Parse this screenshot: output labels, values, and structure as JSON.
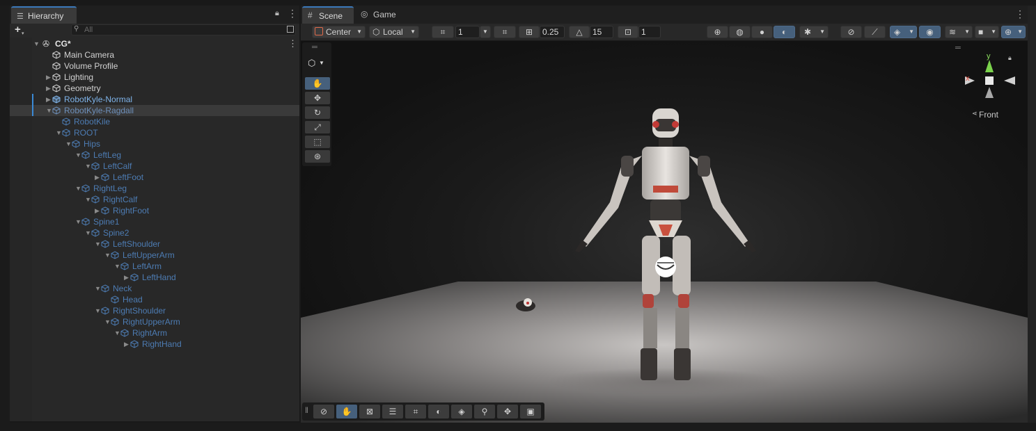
{
  "hierarchy": {
    "tab_label": "Hierarchy",
    "search_placeholder": "All",
    "add_button": "+",
    "scene_name": "CG*",
    "items": [
      {
        "label": "Main Camera",
        "depth": 1,
        "arrow": "none",
        "style": "norm"
      },
      {
        "label": "Volume Profile",
        "depth": 1,
        "arrow": "none",
        "style": "norm"
      },
      {
        "label": "Lighting",
        "depth": 1,
        "arrow": "right",
        "style": "norm"
      },
      {
        "label": "Geometry",
        "depth": 1,
        "arrow": "right",
        "style": "norm"
      },
      {
        "label": "RobotKyle-Normal",
        "depth": 1,
        "arrow": "right",
        "style": "prefab"
      },
      {
        "label": "RobotKyle-Ragdall",
        "depth": 1,
        "arrow": "down",
        "style": "prefabdim",
        "selected": true
      },
      {
        "label": "RobotKile",
        "depth": 2,
        "arrow": "none",
        "style": "blue"
      },
      {
        "label": "ROOT",
        "depth": 2,
        "arrow": "down",
        "style": "blue"
      },
      {
        "label": "Hips",
        "depth": 3,
        "arrow": "down",
        "style": "blue"
      },
      {
        "label": "LeftLeg",
        "depth": 4,
        "arrow": "down",
        "style": "blue"
      },
      {
        "label": "LeftCalf",
        "depth": 5,
        "arrow": "down",
        "style": "blue"
      },
      {
        "label": "LeftFoot",
        "depth": 6,
        "arrow": "right",
        "style": "blue"
      },
      {
        "label": "RightLeg",
        "depth": 4,
        "arrow": "down",
        "style": "blue"
      },
      {
        "label": "RightCalf",
        "depth": 5,
        "arrow": "down",
        "style": "blue"
      },
      {
        "label": "RightFoot",
        "depth": 6,
        "arrow": "right",
        "style": "blue"
      },
      {
        "label": "Spine1",
        "depth": 4,
        "arrow": "down",
        "style": "blue"
      },
      {
        "label": "Spine2",
        "depth": 5,
        "arrow": "down",
        "style": "blue"
      },
      {
        "label": "LeftShoulder",
        "depth": 6,
        "arrow": "down",
        "style": "blue"
      },
      {
        "label": "LeftUpperArm",
        "depth": 7,
        "arrow": "down",
        "style": "blue"
      },
      {
        "label": "LeftArm",
        "depth": 8,
        "arrow": "down",
        "style": "blue"
      },
      {
        "label": "LeftHand",
        "depth": 9,
        "arrow": "right",
        "style": "blue"
      },
      {
        "label": "Neck",
        "depth": 6,
        "arrow": "down",
        "style": "blue"
      },
      {
        "label": "Head",
        "depth": 7,
        "arrow": "none",
        "style": "blue"
      },
      {
        "label": "RightShoulder",
        "depth": 6,
        "arrow": "down",
        "style": "blue"
      },
      {
        "label": "RightUpperArm",
        "depth": 7,
        "arrow": "down",
        "style": "blue"
      },
      {
        "label": "RightArm",
        "depth": 8,
        "arrow": "down",
        "style": "blue"
      },
      {
        "label": "RightHand",
        "depth": 9,
        "arrow": "right",
        "style": "blue"
      }
    ]
  },
  "scene": {
    "tab_scene": "Scene",
    "tab_game": "Game",
    "pivot_mode": "Center",
    "pivot_rotation": "Local",
    "grid_size": "1",
    "snap_move": "0.25",
    "snap_rotate": "15",
    "snap_scale": "1",
    "gizmo_axis_y": "y",
    "gizmo_axis_x": "x",
    "view_label": "Front"
  },
  "colors": {
    "accent": "#3a79bb",
    "active_button": "#46607c",
    "prefab_text": "#7fb4ea",
    "child_text": "#4d7cb3"
  }
}
